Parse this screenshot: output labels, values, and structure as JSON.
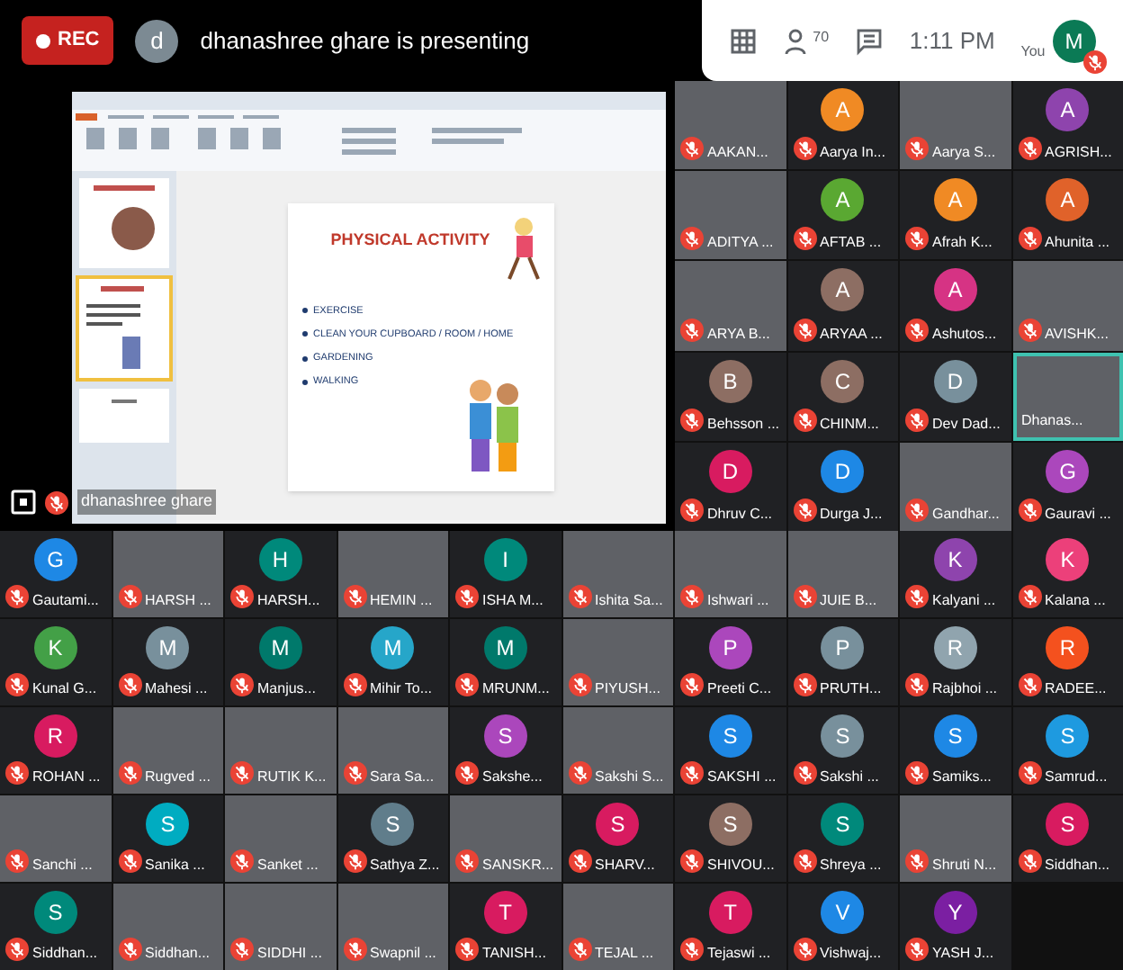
{
  "top_bar": {
    "rec_label": "REC",
    "presenter_initial": "d",
    "presenting_text": "dhanashree ghare is presenting"
  },
  "controls": {
    "participant_count": "70",
    "time": "1:11 PM",
    "self_label": "You",
    "self_initial": "M",
    "self_muted": true
  },
  "presentation": {
    "slide": {
      "title": "PHYSICAL ACTIVITY",
      "bullets": [
        "EXERCISE",
        "CLEAN YOUR CUPBOARD / ROOM / HOME",
        "GARDENING",
        "WALKING"
      ]
    },
    "presenter_name": "dhanashree ghare",
    "presenter_muted": true
  },
  "side_tiles": [
    {
      "kind": "video",
      "name": "AAKAN...",
      "muted": true,
      "highlighted": false
    },
    {
      "kind": "avatar",
      "initial": "A",
      "color": "#f08a24",
      "name": "Aarya In...",
      "muted": true,
      "highlighted": false
    },
    {
      "kind": "video",
      "name": "Aarya S...",
      "muted": true,
      "highlighted": false
    },
    {
      "kind": "avatar",
      "initial": "A",
      "color": "#8e44ad",
      "name": "AGRISH...",
      "muted": true,
      "highlighted": false
    },
    {
      "kind": "video",
      "name": "ADITYA ...",
      "muted": true,
      "highlighted": false
    },
    {
      "kind": "avatar",
      "initial": "A",
      "color": "#5aa832",
      "name": "AFTAB ...",
      "muted": true,
      "highlighted": false
    },
    {
      "kind": "avatar",
      "initial": "A",
      "color": "#f08a24",
      "name": "Afrah K...",
      "muted": true,
      "highlighted": false
    },
    {
      "kind": "avatar",
      "initial": "A",
      "color": "#e0622a",
      "name": "Ahunita ...",
      "muted": true,
      "highlighted": false
    },
    {
      "kind": "video",
      "name": "ARYA B...",
      "muted": true,
      "highlighted": false
    },
    {
      "kind": "avatar",
      "initial": "A",
      "color": "#8d6e63",
      "name": "ARYAA ...",
      "muted": true,
      "highlighted": false
    },
    {
      "kind": "avatar",
      "initial": "A",
      "color": "#d63384",
      "name": "Ashutos...",
      "muted": true,
      "highlighted": false
    },
    {
      "kind": "video",
      "name": "AVISHK...",
      "muted": true,
      "highlighted": false
    },
    {
      "kind": "avatar",
      "initial": "B",
      "color": "#8d6e63",
      "name": "Behsson ...",
      "muted": true,
      "highlighted": false
    },
    {
      "kind": "avatar",
      "initial": "C",
      "color": "#8d6e63",
      "name": "CHINM...",
      "muted": true,
      "highlighted": false
    },
    {
      "kind": "avatar",
      "initial": "D",
      "color": "#78909c",
      "name": "Dev Dad...",
      "muted": true,
      "highlighted": false
    },
    {
      "kind": "video",
      "name": "Dhanas...",
      "muted": false,
      "highlighted": true
    },
    {
      "kind": "avatar",
      "initial": "D",
      "color": "#d81b60",
      "name": "Dhruv C...",
      "muted": true,
      "highlighted": false
    },
    {
      "kind": "avatar",
      "initial": "D",
      "color": "#1e88e5",
      "name": "Durga J...",
      "muted": true,
      "highlighted": false
    },
    {
      "kind": "video",
      "name": "Gandhar...",
      "muted": true,
      "highlighted": false
    },
    {
      "kind": "avatar",
      "initial": "G",
      "color": "#ab47bc",
      "name": "Gauravi ...",
      "muted": true,
      "highlighted": false
    }
  ],
  "grid_tiles": [
    {
      "kind": "avatar",
      "initial": "G",
      "color": "#1e88e5",
      "name": "Gautami...",
      "muted": true
    },
    {
      "kind": "video",
      "name": "HARSH ...",
      "muted": true
    },
    {
      "kind": "avatar",
      "initial": "H",
      "color": "#00897b",
      "name": "HARSH...",
      "muted": true
    },
    {
      "kind": "video",
      "name": "HEMIN ...",
      "muted": true
    },
    {
      "kind": "avatar",
      "initial": "I",
      "color": "#00897b",
      "name": "ISHA M...",
      "muted": true
    },
    {
      "kind": "video",
      "name": "Ishita Sa...",
      "muted": true
    },
    {
      "kind": "video",
      "name": "Ishwari ...",
      "muted": true
    },
    {
      "kind": "video",
      "name": "JUIE B...",
      "muted": true
    },
    {
      "kind": "avatar",
      "initial": "K",
      "color": "#8e44ad",
      "name": "Kalyani ...",
      "muted": true
    },
    {
      "kind": "avatar",
      "initial": "K",
      "color": "#ec407a",
      "name": "Kalana ...",
      "muted": true
    },
    {
      "kind": "avatar",
      "initial": "K",
      "color": "#43a047",
      "name": "Kunal G...",
      "muted": true
    },
    {
      "kind": "avatar",
      "initial": "M",
      "color": "#78909c",
      "name": "Mahesi ...",
      "muted": true
    },
    {
      "kind": "avatar",
      "initial": "M",
      "color": "#00796b",
      "name": "Manjus...",
      "muted": true
    },
    {
      "kind": "avatar",
      "initial": "M",
      "color": "#26a6c9",
      "name": "Mihir To...",
      "muted": true
    },
    {
      "kind": "avatar",
      "initial": "M",
      "color": "#00796b",
      "name": "MRUNM...",
      "muted": true
    },
    {
      "kind": "video",
      "name": "PIYUSH...",
      "muted": true
    },
    {
      "kind": "avatar",
      "initial": "P",
      "color": "#ab47bc",
      "name": "Preeti C...",
      "muted": true
    },
    {
      "kind": "avatar",
      "initial": "P",
      "color": "#78909c",
      "name": "PRUTH...",
      "muted": true
    },
    {
      "kind": "avatar",
      "initial": "R",
      "color": "#90a4ae",
      "name": "Rajbhoi ...",
      "muted": true
    },
    {
      "kind": "avatar",
      "initial": "R",
      "color": "#f4511e",
      "name": "RADEE...",
      "muted": true
    },
    {
      "kind": "avatar",
      "initial": "R",
      "color": "#d81b60",
      "name": "ROHAN ...",
      "muted": true
    },
    {
      "kind": "video",
      "name": "Rugved ...",
      "muted": true
    },
    {
      "kind": "video",
      "name": "RUTIK K...",
      "muted": true
    },
    {
      "kind": "video",
      "name": "Sara Sa...",
      "muted": true
    },
    {
      "kind": "avatar",
      "initial": "S",
      "color": "#ab47bc",
      "name": "Sakshe...",
      "muted": true
    },
    {
      "kind": "video",
      "name": "Sakshi S...",
      "muted": true
    },
    {
      "kind": "avatar",
      "initial": "S",
      "color": "#1e88e5",
      "name": "SAKSHI ...",
      "muted": true
    },
    {
      "kind": "avatar",
      "initial": "S",
      "color": "#78909c",
      "name": "Sakshi ...",
      "muted": true
    },
    {
      "kind": "avatar",
      "initial": "S",
      "color": "#1e88e5",
      "name": "Samiks...",
      "muted": true
    },
    {
      "kind": "avatar",
      "initial": "S",
      "color": "#1e9ae0",
      "name": "Samrud...",
      "muted": true
    },
    {
      "kind": "video",
      "name": "Sanchi ...",
      "muted": true
    },
    {
      "kind": "avatar",
      "initial": "S",
      "color": "#00acc1",
      "name": "Sanika ...",
      "muted": true
    },
    {
      "kind": "video",
      "name": "Sanket ...",
      "muted": true
    },
    {
      "kind": "avatar",
      "initial": "S",
      "color": "#607d8b",
      "name": "Sathya Z...",
      "muted": true
    },
    {
      "kind": "video",
      "name": "SANSKR...",
      "muted": true
    },
    {
      "kind": "avatar",
      "initial": "S",
      "color": "#d81b60",
      "name": "SHARV...",
      "muted": true
    },
    {
      "kind": "avatar",
      "initial": "S",
      "color": "#8d6e63",
      "name": "SHIVOU...",
      "muted": true
    },
    {
      "kind": "avatar",
      "initial": "S",
      "color": "#00897b",
      "name": "Shreya ...",
      "muted": true
    },
    {
      "kind": "video",
      "name": "Shruti N...",
      "muted": true
    },
    {
      "kind": "avatar",
      "initial": "S",
      "color": "#d81b60",
      "name": "Siddhan...",
      "muted": true
    },
    {
      "kind": "avatar",
      "initial": "S",
      "color": "#00897b",
      "name": "Siddhan...",
      "muted": true
    },
    {
      "kind": "video",
      "name": "Siddhan...",
      "muted": true
    },
    {
      "kind": "video",
      "name": "SIDDHI ...",
      "muted": true
    },
    {
      "kind": "video",
      "name": "Swapnil ...",
      "muted": true
    },
    {
      "kind": "avatar",
      "initial": "T",
      "color": "#d81b60",
      "name": "TANISH...",
      "muted": true
    },
    {
      "kind": "video",
      "name": "TEJAL ...",
      "muted": true
    },
    {
      "kind": "avatar",
      "initial": "T",
      "color": "#d81b60",
      "name": "Tejaswi ...",
      "muted": true
    },
    {
      "kind": "avatar",
      "initial": "V",
      "color": "#1e88e5",
      "name": "Vishwaj...",
      "muted": true
    },
    {
      "kind": "avatar",
      "initial": "Y",
      "color": "#7b1fa2",
      "name": "YASH J...",
      "muted": true
    }
  ]
}
